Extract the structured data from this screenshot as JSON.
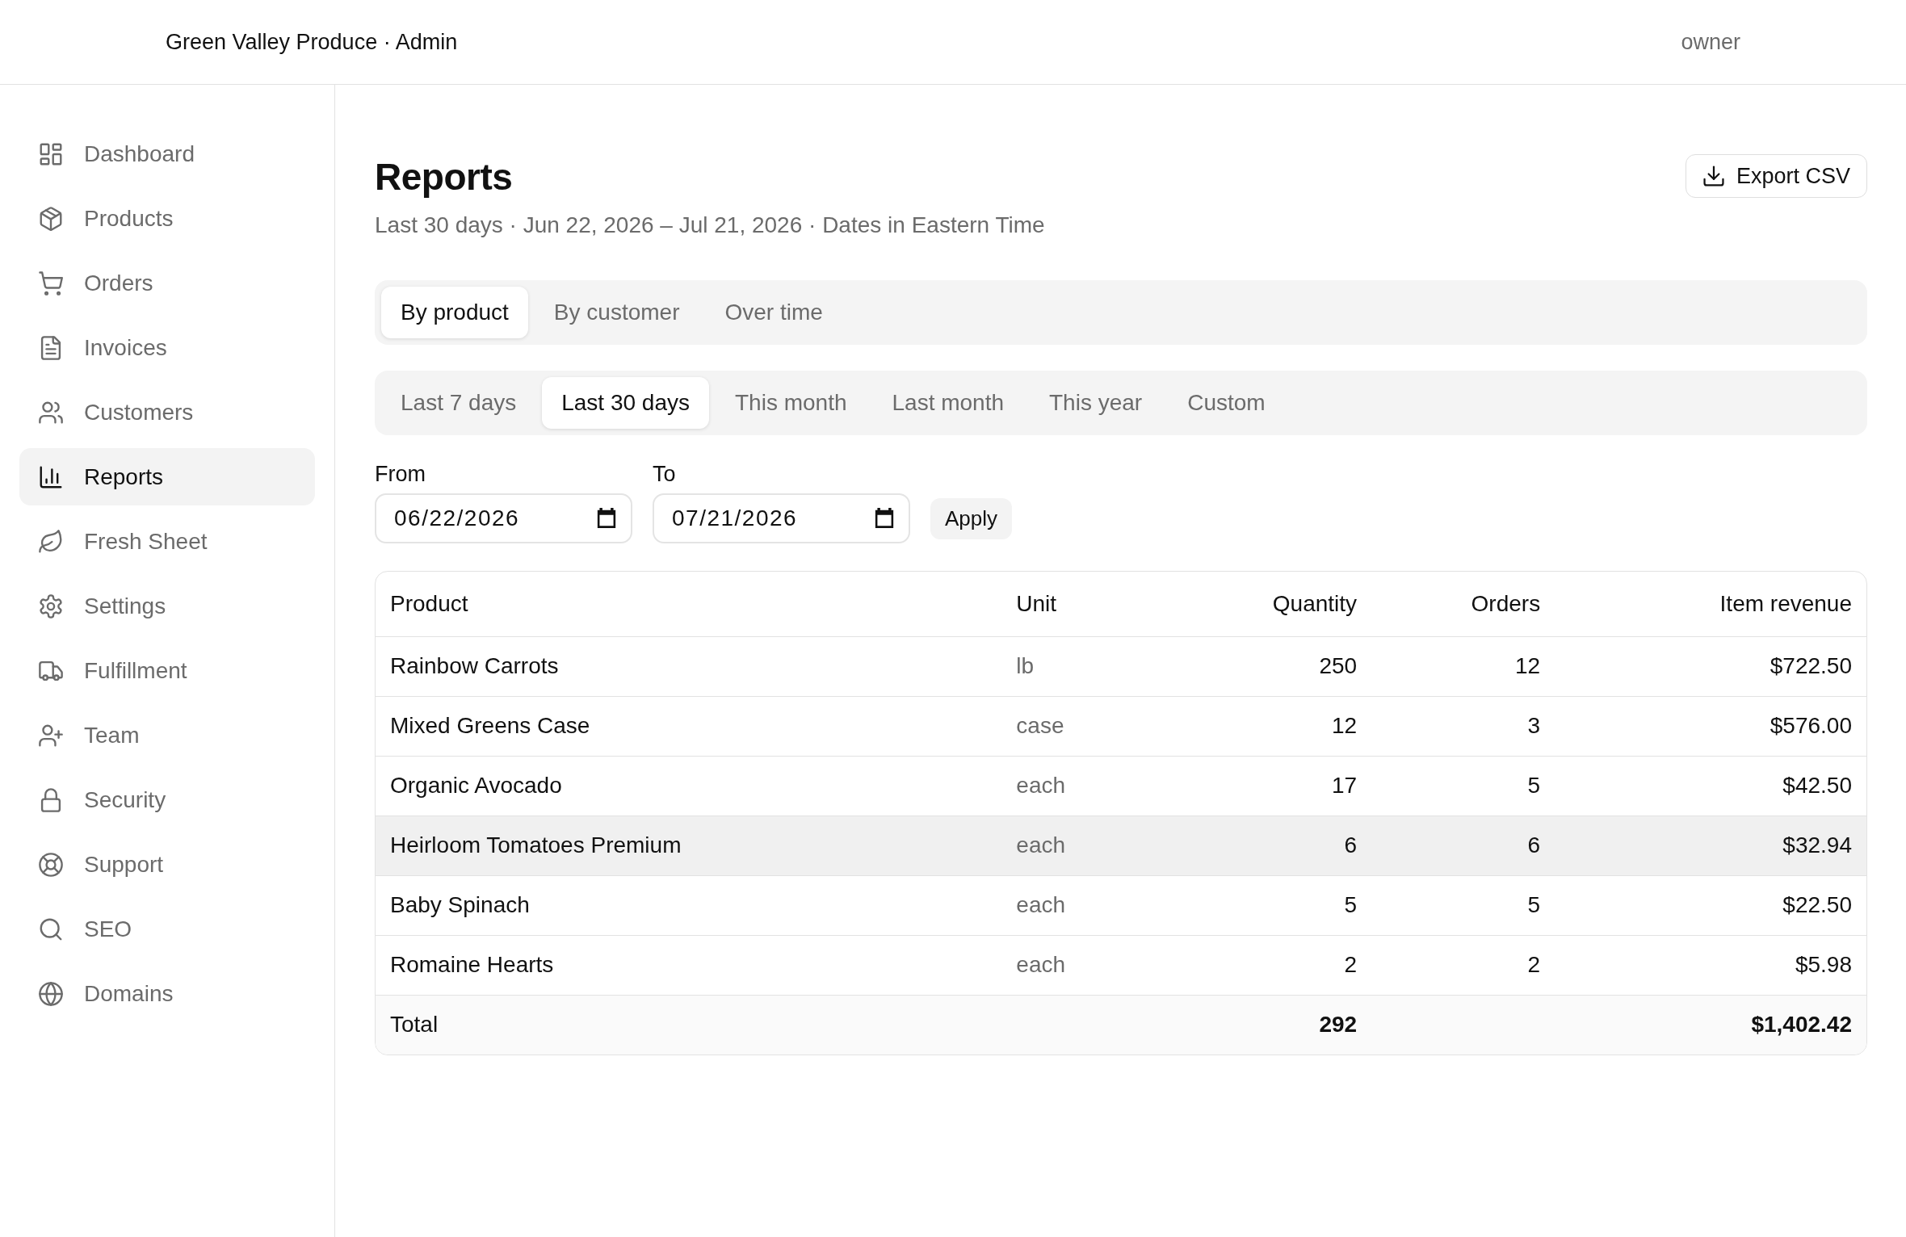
{
  "header": {
    "title": "Green Valley Produce · Admin",
    "user": "owner"
  },
  "sidebar": {
    "items": [
      {
        "label": "Dashboard",
        "selected": false
      },
      {
        "label": "Products",
        "selected": false
      },
      {
        "label": "Orders",
        "selected": false
      },
      {
        "label": "Invoices",
        "selected": false
      },
      {
        "label": "Customers",
        "selected": false
      },
      {
        "label": "Reports",
        "selected": true
      },
      {
        "label": "Fresh Sheet",
        "selected": false
      },
      {
        "label": "Settings",
        "selected": false
      },
      {
        "label": "Fulfillment",
        "selected": false
      },
      {
        "label": "Team",
        "selected": false
      },
      {
        "label": "Security",
        "selected": false
      },
      {
        "label": "Support",
        "selected": false
      },
      {
        "label": "SEO",
        "selected": false
      },
      {
        "label": "Domains",
        "selected": false
      }
    ]
  },
  "page": {
    "title": "Reports",
    "subtitle": "Last 30 days · Jun 22, 2026 – Jul 21, 2026 · Dates in Eastern Time",
    "export_button": "Export CSV"
  },
  "view_tabs": [
    {
      "label": "By product",
      "selected": true
    },
    {
      "label": "By customer",
      "selected": false
    },
    {
      "label": "Over time",
      "selected": false
    }
  ],
  "range_tabs": [
    {
      "label": "Last 7 days",
      "selected": false
    },
    {
      "label": "Last 30 days",
      "selected": true
    },
    {
      "label": "This month",
      "selected": false
    },
    {
      "label": "Last month",
      "selected": false
    },
    {
      "label": "This year",
      "selected": false
    },
    {
      "label": "Custom",
      "selected": false
    }
  ],
  "date_range": {
    "from": {
      "label": "From",
      "value": "06/22/2026"
    },
    "to": {
      "label": "To",
      "value": "07/21/2026"
    },
    "apply_button": "Apply"
  },
  "table": {
    "columns": [
      "Product",
      "Unit",
      "Quantity",
      "Orders",
      "Item revenue"
    ],
    "rows": [
      {
        "product": "Rainbow Carrots",
        "unit": "lb",
        "quantity": "250",
        "orders": "12",
        "revenue": "$722.50",
        "highlighted": false
      },
      {
        "product": "Mixed Greens Case",
        "unit": "case",
        "quantity": "12",
        "orders": "3",
        "revenue": "$576.00",
        "highlighted": false
      },
      {
        "product": "Organic Avocado",
        "unit": "each",
        "quantity": "17",
        "orders": "5",
        "revenue": "$42.50",
        "highlighted": false
      },
      {
        "product": "Heirloom Tomatoes Premium",
        "unit": "each",
        "quantity": "6",
        "orders": "6",
        "revenue": "$32.94",
        "highlighted": true
      },
      {
        "product": "Baby Spinach",
        "unit": "each",
        "quantity": "5",
        "orders": "5",
        "revenue": "$22.50",
        "highlighted": false
      },
      {
        "product": "Romaine Hearts",
        "unit": "each",
        "quantity": "2",
        "orders": "2",
        "revenue": "$5.98",
        "highlighted": false
      }
    ],
    "total": {
      "label": "Total",
      "quantity": "292",
      "revenue": "$1,402.42"
    }
  }
}
